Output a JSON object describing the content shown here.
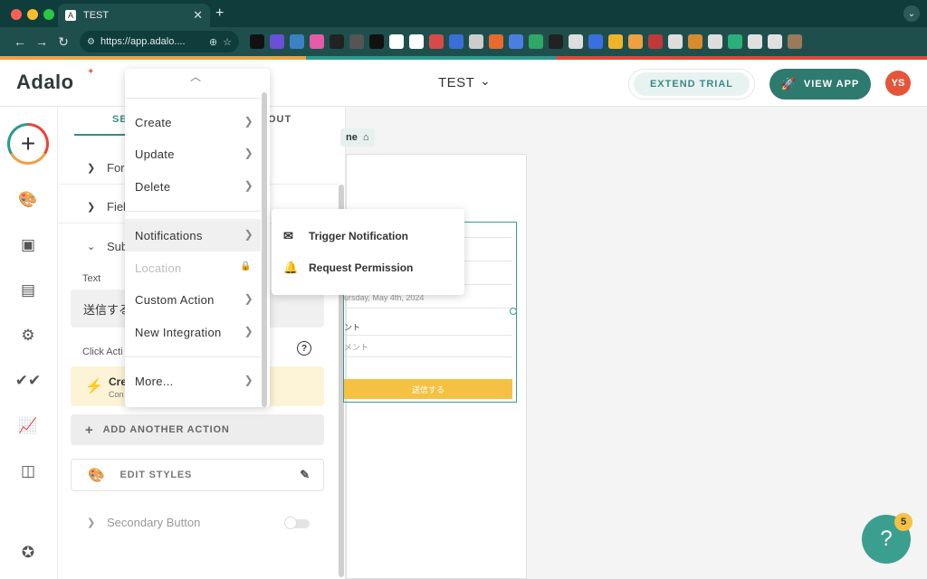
{
  "browser": {
    "tab_title": "TEST",
    "tab_favicon": "A",
    "new_tab": "+",
    "url": "https://app.adalo....",
    "colors": {
      "titlebar": "#0f3d3c",
      "toolbar": "#1f4f4d"
    },
    "extensions": [
      {
        "name": "circle-o-icon",
        "color": "#111111"
      },
      {
        "name": "purple-badge-icon",
        "color": "#6b4fd8"
      },
      {
        "name": "download-icon",
        "color": "#3b82c4"
      },
      {
        "name": "pink-square-icon",
        "color": "#e75aa8"
      },
      {
        "name": "ff-icon",
        "color": "#222222"
      },
      {
        "name": "mic-icon",
        "color": "#555555"
      },
      {
        "name": "hat-icon",
        "color": "#111111"
      },
      {
        "name": "pin-icon",
        "color": "#ffffff"
      },
      {
        "name": "x-icon",
        "color": "#ffffff"
      },
      {
        "name": "red-x-icon",
        "color": "#d84a4a"
      },
      {
        "name": "docs-icon",
        "color": "#3a6fd8"
      },
      {
        "name": "g-icon",
        "color": "#cccccc"
      },
      {
        "name": "m-icon",
        "color": "#e86a2c"
      },
      {
        "name": "triangle-icon",
        "color": "#4a7fe0"
      },
      {
        "name": "green-dots-icon",
        "color": "#2fa866"
      },
      {
        "name": "dark-square-icon",
        "color": "#222222"
      },
      {
        "name": "dropper-icon",
        "color": "#dddddd"
      },
      {
        "name": "bracket-icon",
        "color": "#3b6fe0"
      },
      {
        "name": "color-icon",
        "color": "#f0b429"
      },
      {
        "name": "w-icon",
        "color": "#f0a040"
      },
      {
        "name": "puzzle-red-icon",
        "color": "#c03838"
      },
      {
        "name": "mail-icon",
        "color": "#dddddd"
      },
      {
        "name": "coin-icon",
        "color": "#d88a2c"
      },
      {
        "name": "cloud-icon",
        "color": "#dddddd"
      },
      {
        "name": "m-green-icon",
        "color": "#2ab07a"
      },
      {
        "name": "puzzle-icon",
        "color": "#e0e0e0"
      },
      {
        "name": "sync-icon",
        "color": "#e0e0e0"
      },
      {
        "name": "profile-pic-icon",
        "color": "#9a7a5a"
      }
    ]
  },
  "header": {
    "logo": "Adalo",
    "app_name": "TEST",
    "extend_trial": "EXTEND TRIAL",
    "view_app": "VIEW APP",
    "avatar": "YS",
    "colors": {
      "accent": "#2f7a6f",
      "avatar": "#e4553a"
    }
  },
  "rail": {
    "add": "+",
    "icons": [
      "palette-icon",
      "screens-icon",
      "database-icon",
      "settings-icon",
      "publish-icon",
      "analytics-icon",
      "marketplace-icon",
      "check-badge-icon"
    ]
  },
  "panel": {
    "tab_left": "SE",
    "tab_right": "OUT",
    "row1": "Form",
    "row2": "Fiel",
    "row3": "Sub",
    "text_label": "Text",
    "text_value": "送信する",
    "click_label": "Click Acti",
    "help": "?",
    "action_title": "Crea",
    "action_sub": "Con",
    "add_action": "ADD ANOTHER ACTION",
    "edit_styles": "EDIT STYLES",
    "secondary": "Secondary Button"
  },
  "canvas": {
    "screen_name": "ne",
    "date_placeholder": "ursday, May 4th, 2024",
    "comment_label": "ント",
    "comment_placeholder": "メント",
    "submit": "送信する",
    "accent": "#f5c143"
  },
  "menu": {
    "items": [
      "Create",
      "Update",
      "Delete",
      "Notifications",
      "Location",
      "Custom Action",
      "New Integration",
      "More..."
    ],
    "active": "Notifications",
    "disabled": "Location"
  },
  "submenu": {
    "items": [
      "Trigger Notification",
      "Request Permission"
    ]
  },
  "help_widget": {
    "badge": "5"
  }
}
